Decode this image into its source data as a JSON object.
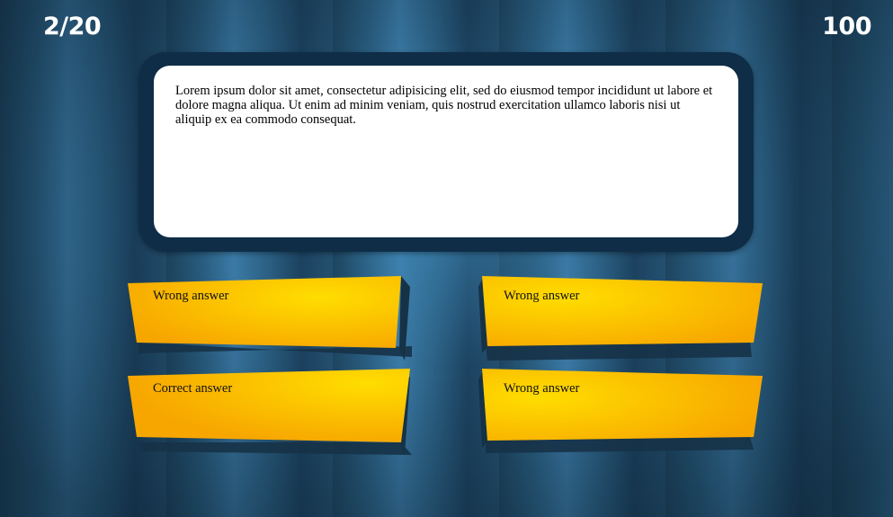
{
  "hud": {
    "progress": "2/20",
    "score": "100"
  },
  "question": {
    "text": "Lorem ipsum dolor sit amet, consectetur adipisicing elit, sed do eiusmod tempor incididunt ut labore et dolore magna aliqua. Ut enim ad minim veniam, quis nostrud exercitation ullamco laboris nisi ut aliquip ex ea commodo consequat."
  },
  "answers": [
    {
      "label": "Wrong answer"
    },
    {
      "label": "Wrong answer"
    },
    {
      "label": "Correct answer"
    },
    {
      "label": "Wrong answer"
    }
  ],
  "colors": {
    "answer_light": "#ffdd00",
    "answer_dark": "#f7a600",
    "frame": "#0f2d47",
    "shadow": "#163247"
  }
}
